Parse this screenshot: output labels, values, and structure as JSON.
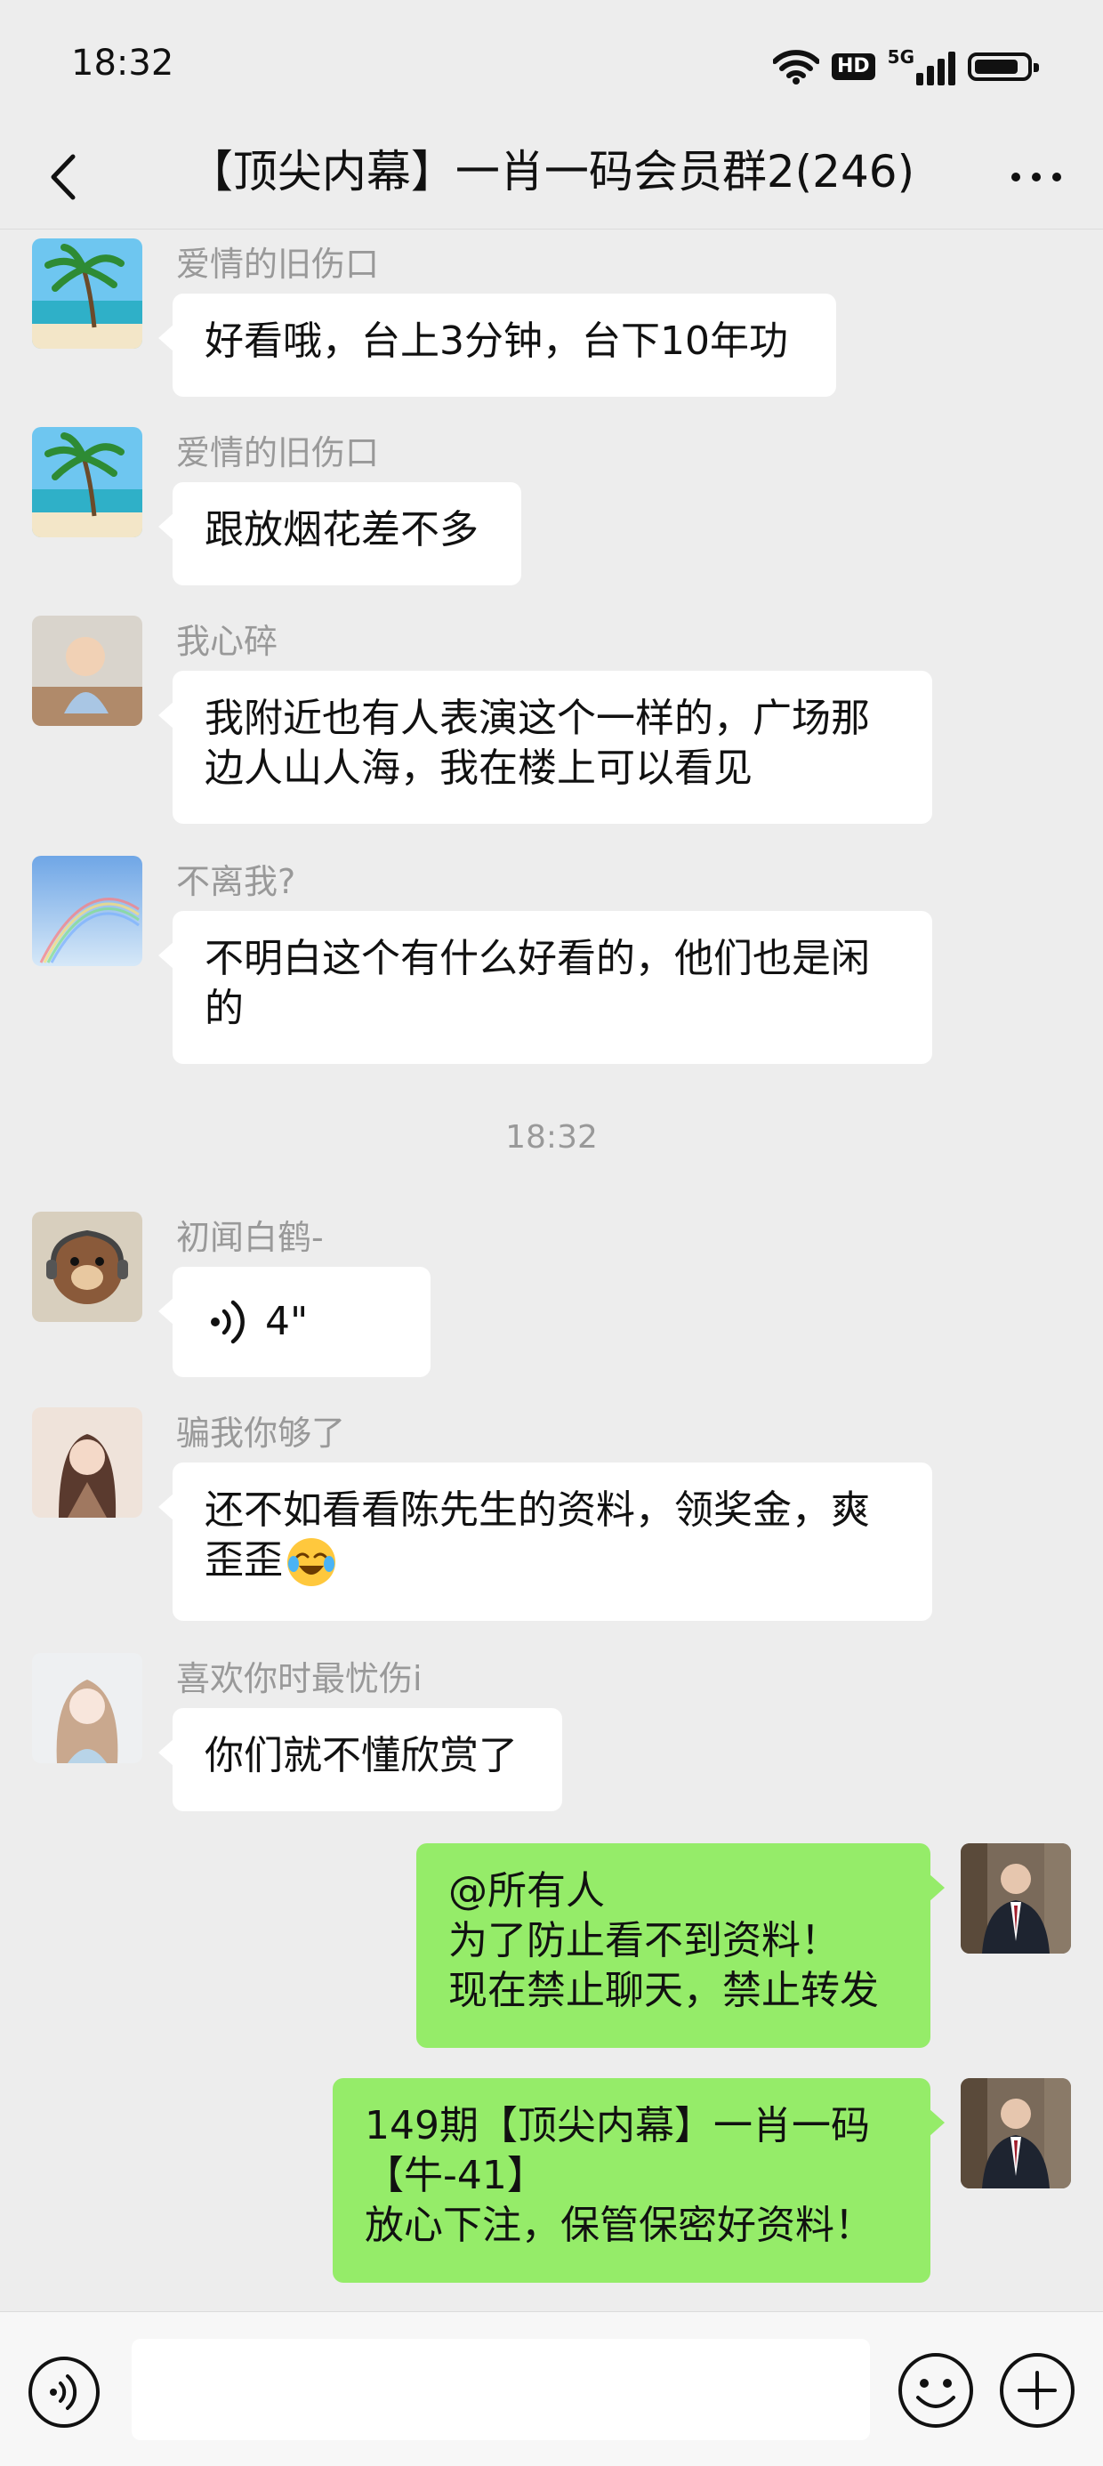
{
  "status_bar": {
    "time": "18:32",
    "hd": "HD",
    "network": "5G"
  },
  "nav": {
    "title": "【顶尖内幕】一肖一码会员群2(246)"
  },
  "messages": [
    {
      "sender": "爱情的旧伤口",
      "lines": [
        "好看哦，台上3分钟，台下10年功"
      ]
    },
    {
      "sender": "爱情的旧伤口",
      "lines": [
        "跟放烟花差不多"
      ]
    },
    {
      "sender": "我心碎",
      "lines": [
        "我附近也有人表演这个一样的，广场那",
        "边人山人海，我在楼上可以看见"
      ]
    },
    {
      "sender": "不离我?",
      "lines": [
        "不明白这个有什么好看的，他们也是闲",
        "的"
      ]
    },
    {
      "timestamp": "18:32"
    },
    {
      "sender": "初闻白鹤-",
      "voice_duration": "4\""
    },
    {
      "sender": "骗我你够了",
      "lines": [
        "还不如看看陈先生的资料，领奖金，爽",
        "歪歪"
      ],
      "emoji": "laughing-crying-emoji"
    },
    {
      "sender": "喜欢你时最忧伤i",
      "lines": [
        "你们就不懂欣赏了"
      ]
    },
    {
      "self": true,
      "lines": [
        "@所有人",
        "为了防止看不到资料！",
        "现在禁止聊天，禁止转发"
      ]
    },
    {
      "self": true,
      "lines": [
        "149期【顶尖内幕】一肖一码",
        "【牛-41】",
        "放心下注，保管保密好资料！"
      ]
    }
  ],
  "colors": {
    "self_bubble": "#95ec69",
    "other_bubble": "#ffffff",
    "background": "#ededed"
  }
}
